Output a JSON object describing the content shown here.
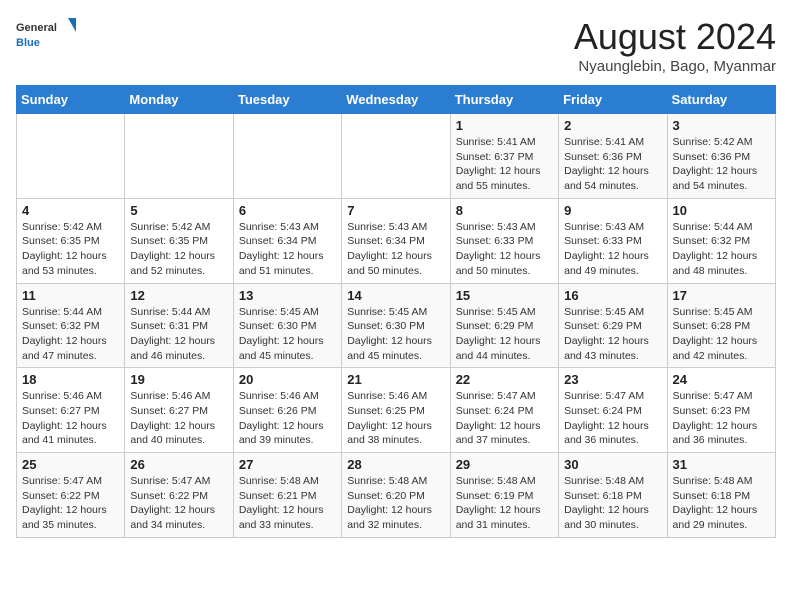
{
  "logo": {
    "general": "General",
    "blue": "Blue"
  },
  "title": "August 2024",
  "location": "Nyaunglebin, Bago, Myanmar",
  "days_of_week": [
    "Sunday",
    "Monday",
    "Tuesday",
    "Wednesday",
    "Thursday",
    "Friday",
    "Saturday"
  ],
  "weeks": [
    [
      {
        "day": "",
        "info": ""
      },
      {
        "day": "",
        "info": ""
      },
      {
        "day": "",
        "info": ""
      },
      {
        "day": "",
        "info": ""
      },
      {
        "day": "1",
        "info": "Sunrise: 5:41 AM\nSunset: 6:37 PM\nDaylight: 12 hours\nand 55 minutes."
      },
      {
        "day": "2",
        "info": "Sunrise: 5:41 AM\nSunset: 6:36 PM\nDaylight: 12 hours\nand 54 minutes."
      },
      {
        "day": "3",
        "info": "Sunrise: 5:42 AM\nSunset: 6:36 PM\nDaylight: 12 hours\nand 54 minutes."
      }
    ],
    [
      {
        "day": "4",
        "info": "Sunrise: 5:42 AM\nSunset: 6:35 PM\nDaylight: 12 hours\nand 53 minutes."
      },
      {
        "day": "5",
        "info": "Sunrise: 5:42 AM\nSunset: 6:35 PM\nDaylight: 12 hours\nand 52 minutes."
      },
      {
        "day": "6",
        "info": "Sunrise: 5:43 AM\nSunset: 6:34 PM\nDaylight: 12 hours\nand 51 minutes."
      },
      {
        "day": "7",
        "info": "Sunrise: 5:43 AM\nSunset: 6:34 PM\nDaylight: 12 hours\nand 50 minutes."
      },
      {
        "day": "8",
        "info": "Sunrise: 5:43 AM\nSunset: 6:33 PM\nDaylight: 12 hours\nand 50 minutes."
      },
      {
        "day": "9",
        "info": "Sunrise: 5:43 AM\nSunset: 6:33 PM\nDaylight: 12 hours\nand 49 minutes."
      },
      {
        "day": "10",
        "info": "Sunrise: 5:44 AM\nSunset: 6:32 PM\nDaylight: 12 hours\nand 48 minutes."
      }
    ],
    [
      {
        "day": "11",
        "info": "Sunrise: 5:44 AM\nSunset: 6:32 PM\nDaylight: 12 hours\nand 47 minutes."
      },
      {
        "day": "12",
        "info": "Sunrise: 5:44 AM\nSunset: 6:31 PM\nDaylight: 12 hours\nand 46 minutes."
      },
      {
        "day": "13",
        "info": "Sunrise: 5:45 AM\nSunset: 6:30 PM\nDaylight: 12 hours\nand 45 minutes."
      },
      {
        "day": "14",
        "info": "Sunrise: 5:45 AM\nSunset: 6:30 PM\nDaylight: 12 hours\nand 45 minutes."
      },
      {
        "day": "15",
        "info": "Sunrise: 5:45 AM\nSunset: 6:29 PM\nDaylight: 12 hours\nand 44 minutes."
      },
      {
        "day": "16",
        "info": "Sunrise: 5:45 AM\nSunset: 6:29 PM\nDaylight: 12 hours\nand 43 minutes."
      },
      {
        "day": "17",
        "info": "Sunrise: 5:45 AM\nSunset: 6:28 PM\nDaylight: 12 hours\nand 42 minutes."
      }
    ],
    [
      {
        "day": "18",
        "info": "Sunrise: 5:46 AM\nSunset: 6:27 PM\nDaylight: 12 hours\nand 41 minutes."
      },
      {
        "day": "19",
        "info": "Sunrise: 5:46 AM\nSunset: 6:27 PM\nDaylight: 12 hours\nand 40 minutes."
      },
      {
        "day": "20",
        "info": "Sunrise: 5:46 AM\nSunset: 6:26 PM\nDaylight: 12 hours\nand 39 minutes."
      },
      {
        "day": "21",
        "info": "Sunrise: 5:46 AM\nSunset: 6:25 PM\nDaylight: 12 hours\nand 38 minutes."
      },
      {
        "day": "22",
        "info": "Sunrise: 5:47 AM\nSunset: 6:24 PM\nDaylight: 12 hours\nand 37 minutes."
      },
      {
        "day": "23",
        "info": "Sunrise: 5:47 AM\nSunset: 6:24 PM\nDaylight: 12 hours\nand 36 minutes."
      },
      {
        "day": "24",
        "info": "Sunrise: 5:47 AM\nSunset: 6:23 PM\nDaylight: 12 hours\nand 36 minutes."
      }
    ],
    [
      {
        "day": "25",
        "info": "Sunrise: 5:47 AM\nSunset: 6:22 PM\nDaylight: 12 hours\nand 35 minutes."
      },
      {
        "day": "26",
        "info": "Sunrise: 5:47 AM\nSunset: 6:22 PM\nDaylight: 12 hours\nand 34 minutes."
      },
      {
        "day": "27",
        "info": "Sunrise: 5:48 AM\nSunset: 6:21 PM\nDaylight: 12 hours\nand 33 minutes."
      },
      {
        "day": "28",
        "info": "Sunrise: 5:48 AM\nSunset: 6:20 PM\nDaylight: 12 hours\nand 32 minutes."
      },
      {
        "day": "29",
        "info": "Sunrise: 5:48 AM\nSunset: 6:19 PM\nDaylight: 12 hours\nand 31 minutes."
      },
      {
        "day": "30",
        "info": "Sunrise: 5:48 AM\nSunset: 6:18 PM\nDaylight: 12 hours\nand 30 minutes."
      },
      {
        "day": "31",
        "info": "Sunrise: 5:48 AM\nSunset: 6:18 PM\nDaylight: 12 hours\nand 29 minutes."
      }
    ]
  ]
}
